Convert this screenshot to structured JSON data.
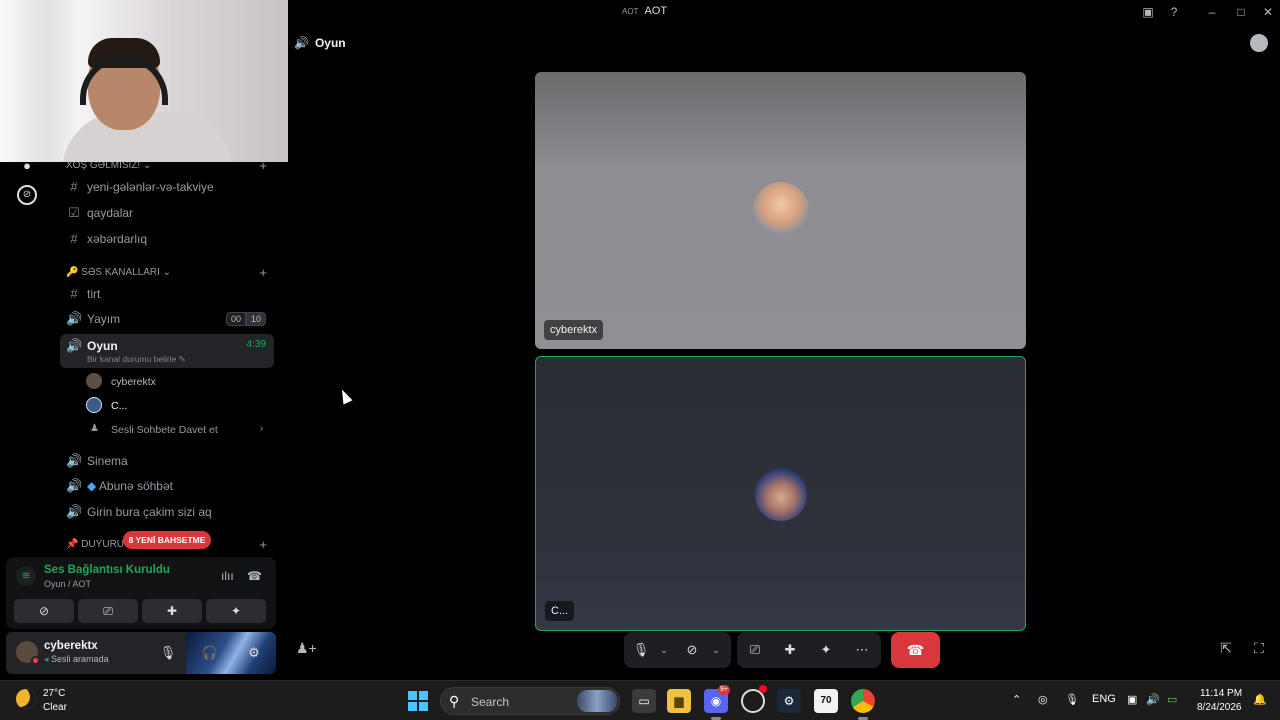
{
  "window": {
    "title": "AOT",
    "server_mark": "AOT"
  },
  "stage": {
    "channel_title": "Oyun"
  },
  "sidebar": {
    "category_welcome": "XOŞ GƏLMİSİZ!",
    "text_channels": [
      {
        "label": "yeni-gələnlər-və-takviye",
        "icon": "hash-icon"
      },
      {
        "label": "qaydalar",
        "icon": "rules-icon"
      },
      {
        "label": "xəbərdarlıq",
        "icon": "hash-icon"
      }
    ],
    "category_voice": "SƏS KANALLARI",
    "voice_channels": [
      {
        "label": "tirt",
        "icon": "hash-icon"
      },
      {
        "label": "Yayım",
        "icon": "speaker-icon",
        "count_a": "00",
        "count_b": "10"
      },
      {
        "label": "Oyun",
        "icon": "speaker-icon",
        "timer": "4:39",
        "status": "Bir kanal durumu belirle"
      },
      {
        "label": "Sinema",
        "icon": "speaker-icon"
      },
      {
        "label": "Abunə söhbət",
        "icon": "speaker-icon"
      },
      {
        "label": "Girin bura çakim sizi aq",
        "icon": "speaker-icon"
      }
    ],
    "members": [
      {
        "name": "cyberektx"
      },
      {
        "name": "C..."
      }
    ],
    "invite_label": "Sesli Sohbete Davet et",
    "category_announce": "DUYURU",
    "new_mentions": "8 YENİ BAHSETME"
  },
  "voice_panel": {
    "status": "Ses Bağlantısı Kuruldu",
    "location": "Oyun / AOT"
  },
  "user_panel": {
    "name": "cyberektx",
    "status": "Sesli aramada"
  },
  "tiles": [
    {
      "name": "cyberektx"
    },
    {
      "name": "C..."
    }
  ],
  "taskbar": {
    "temperature": "27°C",
    "condition": "Clear",
    "search_label": "Search",
    "app_badge": "70",
    "discord_badge": "9+",
    "language": "ENG",
    "time": "11:14 PM",
    "date": "8/24/2026"
  },
  "colors": {
    "accent_green": "#23a55a",
    "hangup_red": "#da373c",
    "badge_red": "#da373c"
  }
}
